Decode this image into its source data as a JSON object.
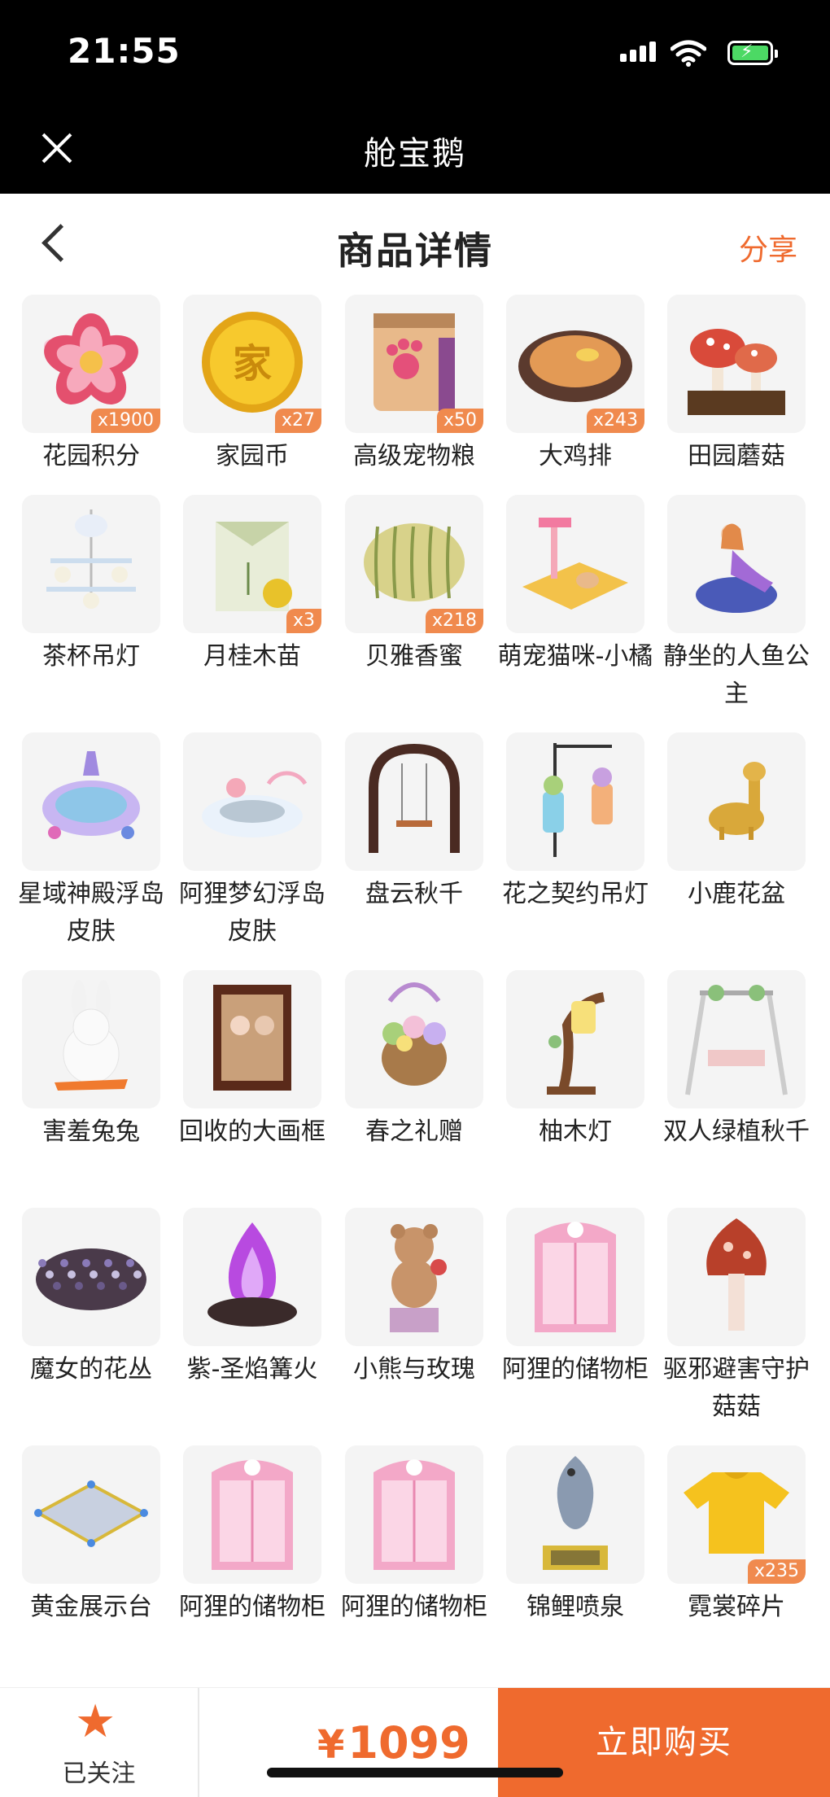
{
  "status": {
    "time": "21:55"
  },
  "app": {
    "title": "舱宝鹅"
  },
  "nav": {
    "title": "商品详情",
    "share": "分享"
  },
  "items": [
    {
      "name": "花园积分",
      "qty": "x1900",
      "icon": "flower-badge"
    },
    {
      "name": "家园币",
      "qty": "x27",
      "icon": "gold-coin"
    },
    {
      "name": "高级宠物粮",
      "qty": "x50",
      "icon": "pet-food-bag"
    },
    {
      "name": "大鸡排",
      "qty": "x243",
      "icon": "fried-chicken"
    },
    {
      "name": "田园蘑菇",
      "qty": "",
      "icon": "mushrooms"
    },
    {
      "name": "茶杯吊灯",
      "qty": "",
      "icon": "teacup-chandelier"
    },
    {
      "name": "月桂木苗",
      "qty": "x3",
      "icon": "seed-pack"
    },
    {
      "name": "贝雅香蜜",
      "qty": "x218",
      "icon": "melon"
    },
    {
      "name": "萌宠猫咪-小橘",
      "qty": "",
      "icon": "cat-tower"
    },
    {
      "name": "静坐的人鱼公主",
      "qty": "",
      "icon": "mermaid"
    },
    {
      "name": "星域神殿浮岛皮肤",
      "qty": "",
      "icon": "floating-island-purple"
    },
    {
      "name": "阿狸梦幻浮岛皮肤",
      "qty": "",
      "icon": "floating-island-cloud"
    },
    {
      "name": "盘云秋千",
      "qty": "",
      "icon": "swing-arch"
    },
    {
      "name": "花之契约吊灯",
      "qty": "",
      "icon": "hanging-lanterns"
    },
    {
      "name": "小鹿花盆",
      "qty": "",
      "icon": "deer-planter"
    },
    {
      "name": "害羞兔兔",
      "qty": "",
      "icon": "bunny"
    },
    {
      "name": "回收的大画框",
      "qty": "",
      "icon": "picture-frame"
    },
    {
      "name": "春之礼赠",
      "qty": "",
      "icon": "flower-basket"
    },
    {
      "name": "柚木灯",
      "qty": "",
      "icon": "tree-lamp"
    },
    {
      "name": "双人绿植秋千",
      "qty": "",
      "icon": "garden-swing"
    },
    {
      "name": "魔女的花丛",
      "qty": "",
      "icon": "dark-flower-bush"
    },
    {
      "name": "紫-圣焰篝火",
      "qty": "",
      "icon": "purple-bonfire"
    },
    {
      "name": "小熊与玫瑰",
      "qty": "",
      "icon": "teddy-bear"
    },
    {
      "name": "阿狸的储物柜",
      "qty": "",
      "icon": "pink-cabinet"
    },
    {
      "name": "驱邪避害守护菇菇",
      "qty": "",
      "icon": "guardian-mushroom"
    },
    {
      "name": "黄金展示台",
      "qty": "",
      "icon": "display-platform"
    },
    {
      "name": "阿狸的储物柜",
      "qty": "",
      "icon": "pink-cabinet"
    },
    {
      "name": "阿狸的储物柜",
      "qty": "",
      "icon": "pink-cabinet"
    },
    {
      "name": "锦鲤喷泉",
      "qty": "",
      "icon": "koi-fountain"
    },
    {
      "name": "霓裳碎片",
      "qty": "x235",
      "icon": "yellow-shirt"
    }
  ],
  "footer": {
    "follow_label": "已关注",
    "currency": "¥",
    "price": "1099",
    "buy_label": "立即购买"
  },
  "colors": {
    "accent": "#ef6a2e",
    "badge": "#f08a4e"
  }
}
